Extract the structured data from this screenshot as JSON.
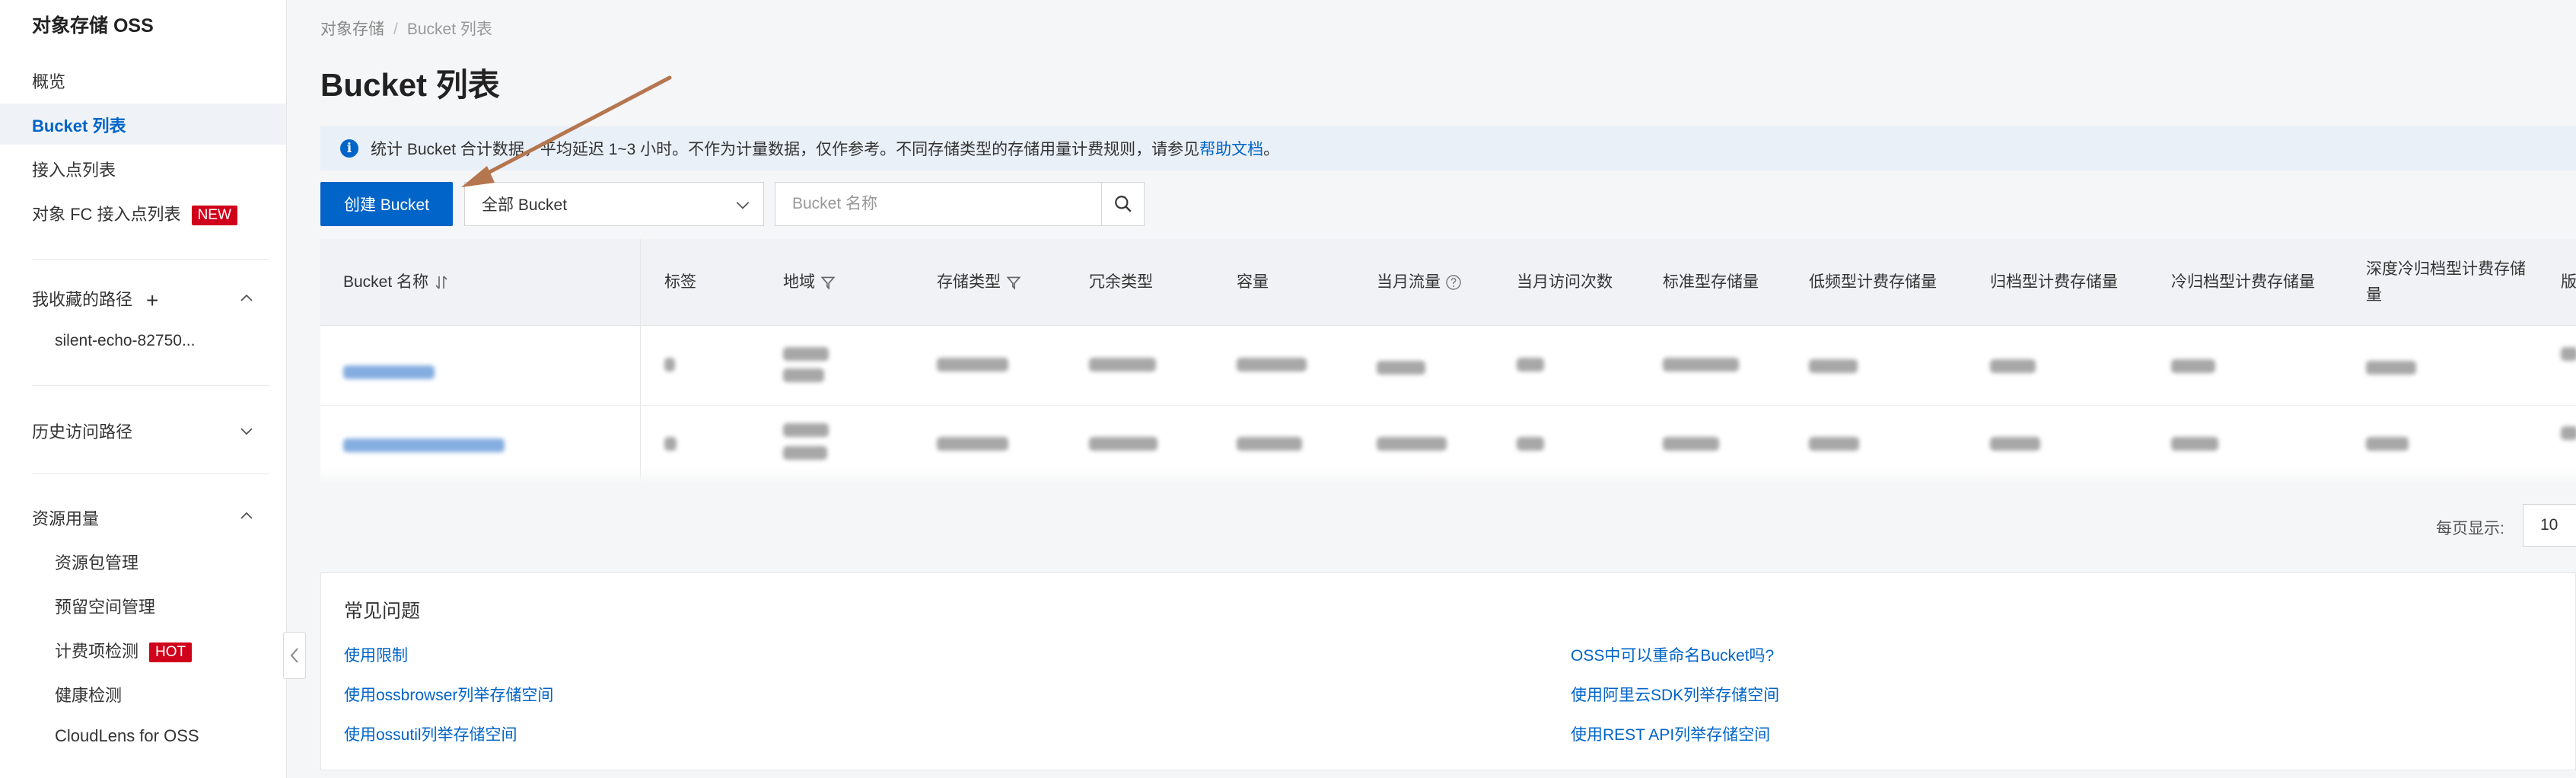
{
  "sidebar": {
    "title": "对象存储 OSS",
    "items": [
      {
        "label": "概览"
      },
      {
        "label": "Bucket 列表"
      },
      {
        "label": "接入点列表"
      },
      {
        "label": "对象 FC 接入点列表",
        "badge": "NEW"
      }
    ],
    "favorites": {
      "label": "我收藏的路径",
      "items": [
        "silent-echo-82750..."
      ]
    },
    "history": {
      "label": "历史访问路径"
    },
    "resources": {
      "label": "资源用量",
      "items": [
        {
          "label": "资源包管理"
        },
        {
          "label": "预留空间管理"
        },
        {
          "label": "计费项检测",
          "badge": "HOT"
        },
        {
          "label": "健康检测"
        },
        {
          "label": "CloudLens for OSS"
        }
      ]
    }
  },
  "breadcrumb": {
    "root": "对象存储",
    "current": "Bucket 列表"
  },
  "page_title": "Bucket 列表",
  "notice": {
    "text": "统计 Bucket 合计数据，平均延迟 1~3 小时。不作为计量数据，仅作参考。不同存储类型的存储用量计费规则，请参见",
    "link": "帮助文档",
    "end": "。"
  },
  "toolbar": {
    "create_label": "创建 Bucket",
    "filter_value": "全部 Bucket",
    "search_placeholder": "Bucket 名称"
  },
  "table": {
    "columns": [
      "Bucket 名称",
      "标签",
      "地域",
      "存储类型",
      "冗余类型",
      "容量",
      "当月流量",
      "当月访问次数",
      "标准型存储量",
      "低频型计费存储量",
      "归档型计费存储量",
      "冷归档型计费存储量",
      "深度冷归档型计费存储量",
      "版"
    ]
  },
  "pager": {
    "label": "每页显示:",
    "value": "10"
  },
  "faq": {
    "title": "常见问题",
    "left": [
      "使用限制",
      "使用ossbrowser列举存储空间",
      "使用ossutil列举存储空间"
    ],
    "right": [
      "OSS中可以重命名Bucket吗?",
      "使用阿里云SDK列举存储空间",
      "使用REST API列举存储空间"
    ]
  },
  "colors": {
    "primary": "#0064c8",
    "badge": "#d0021b",
    "annotation_arrow": "#b5764f"
  }
}
